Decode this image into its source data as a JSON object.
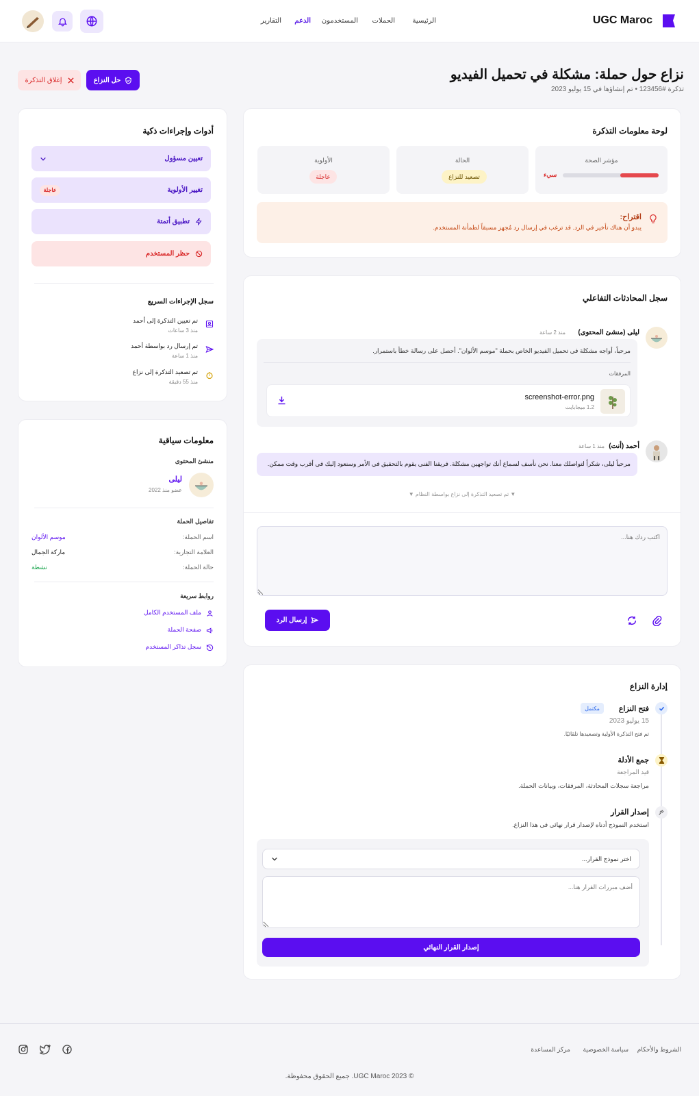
{
  "header": {
    "brand": "UGC Maroc",
    "nav": [
      "الرئيسية",
      "الحملات",
      "المستخدمون",
      "الدعم",
      "التقارير"
    ],
    "active_nav": "الدعم"
  },
  "page": {
    "title": "نزاع حول حملة: مشكلة في تحميل الفيديو",
    "subtitle": "تذكرة #123456 • تم إنشاؤها في 15 يوليو 2023",
    "resolve_label": "حل النزاع",
    "close_label": "إغلاق التذكرة"
  },
  "dashboard": {
    "title": "لوحة معلومات التذكرة",
    "health_label": "مؤشر الصحة",
    "health_value": "سيء",
    "health_fraction": 0.4,
    "status_label": "الحالة",
    "status_value": "تصعيد للنزاع",
    "priority_label": "الأولوية",
    "priority_value": "عاجلة",
    "suggestion_title": "اقتراح:",
    "suggestion_text": "يبدو أن هناك تأخير في الرد. قد ترغب في إرسال رد مُجهز مسبقاً لطمأنة المستخدم."
  },
  "conversation": {
    "title": "سجل المحادثات التفاعلي",
    "msg1_author": "ليلى (منشئ المحتوى)",
    "msg1_time": "منذ 2 ساعة",
    "msg1_text": "مرحباً، أواجه مشكلة في تحميل الفيديو الخاص بحملة \"موسم الألوان\". أحصل على رسالة خطأ باستمرار.",
    "attachments_label": "المرفقات",
    "file_name": "screenshot-error.png",
    "file_size": "1.2 ميجابايت",
    "msg2_author": "أحمد (أنت)",
    "msg2_time": "منذ 1 ساعة",
    "msg2_text": "مرحباً ليلى، شكراً لتواصلك معنا. نحن نأسف لسماع أنك تواجهين مشكلة. فريقنا الفني يقوم بالتحقيق في الأمر وسنعود إليك في أقرب وقت ممكن.",
    "system_note": "▼ تم تصعيد التذكرة إلى نزاع بواسطة النظام ▼",
    "reply_placeholder": "اكتب ردك هنا...",
    "send_label": "إرسال الرد"
  },
  "dispute": {
    "title": "إدارة النزاع",
    "step1_title": "فتح النزاع",
    "step1_badge": "مكتمل",
    "step1_date": "15 يوليو 2023",
    "step1_desc": "تم فتح التذكرة الأولية وتصعيدها تلقائيًا.",
    "step2_title": "جمع الأدلة",
    "step2_status": "قيد المراجعة",
    "step2_desc": "مراجعة سجلات المحادثة، المرفقات، وبيانات الحملة.",
    "step3_title": "إصدار القرار",
    "step3_desc": "استخدم النموذج أدناه لإصدار قرار نهائي في هذا النزاع.",
    "select_placeholder": "اختر نموذج القرار...",
    "textarea_placeholder": "أضف مبررات القرار هنا...",
    "submit_label": "إصدار القرار النهائي"
  },
  "tools": {
    "title": "أدوات وإجراءات ذكية",
    "assign": "تعيين مسؤول",
    "priority": "تغيير الأولوية",
    "priority_badge": "عاجلة",
    "automation": "تطبيق أتمتة",
    "ban": "حظر المستخدم",
    "log_title": "سجل الإجراءات السريع",
    "log": [
      {
        "text": "تم تعيين التذكرة إلى أحمد",
        "time": "منذ 3 ساعات"
      },
      {
        "text": "تم إرسال رد بواسطة أحمد",
        "time": "منذ 1 ساعة"
      },
      {
        "text": "تم تصعيد التذكرة إلى نزاع",
        "time": "منذ 55 دقيقة"
      }
    ]
  },
  "context": {
    "title": "معلومات سياقية",
    "creator_label": "منشئ المحتوى",
    "creator_name": "ليلى",
    "creator_since": "عضو منذ 2022",
    "campaign_title": "تفاصيل الحملة",
    "rows": [
      {
        "label": "اسم الحملة:",
        "value": "موسم الألوان"
      },
      {
        "label": "العلامة التجارية:",
        "value": "ماركة الجمال"
      },
      {
        "label": "حالة الحملة:",
        "value": "نشطة"
      }
    ],
    "links_title": "روابط سريعة",
    "links": [
      "ملف المستخدم الكامل",
      "صفحة الحملة",
      "سجل تذاكر المستخدم"
    ]
  },
  "footer": {
    "links": [
      "الشروط والأحكام",
      "سياسة الخصوصية",
      "مركز المساعدة"
    ],
    "copyright": "© 2023 UGC Maroc. جميع الحقوق محفوظة."
  },
  "colors": {
    "primary": "#5b0ef0",
    "danger": "#d92a2a",
    "success": "#16a34a",
    "lavender": "#ede7fd"
  }
}
